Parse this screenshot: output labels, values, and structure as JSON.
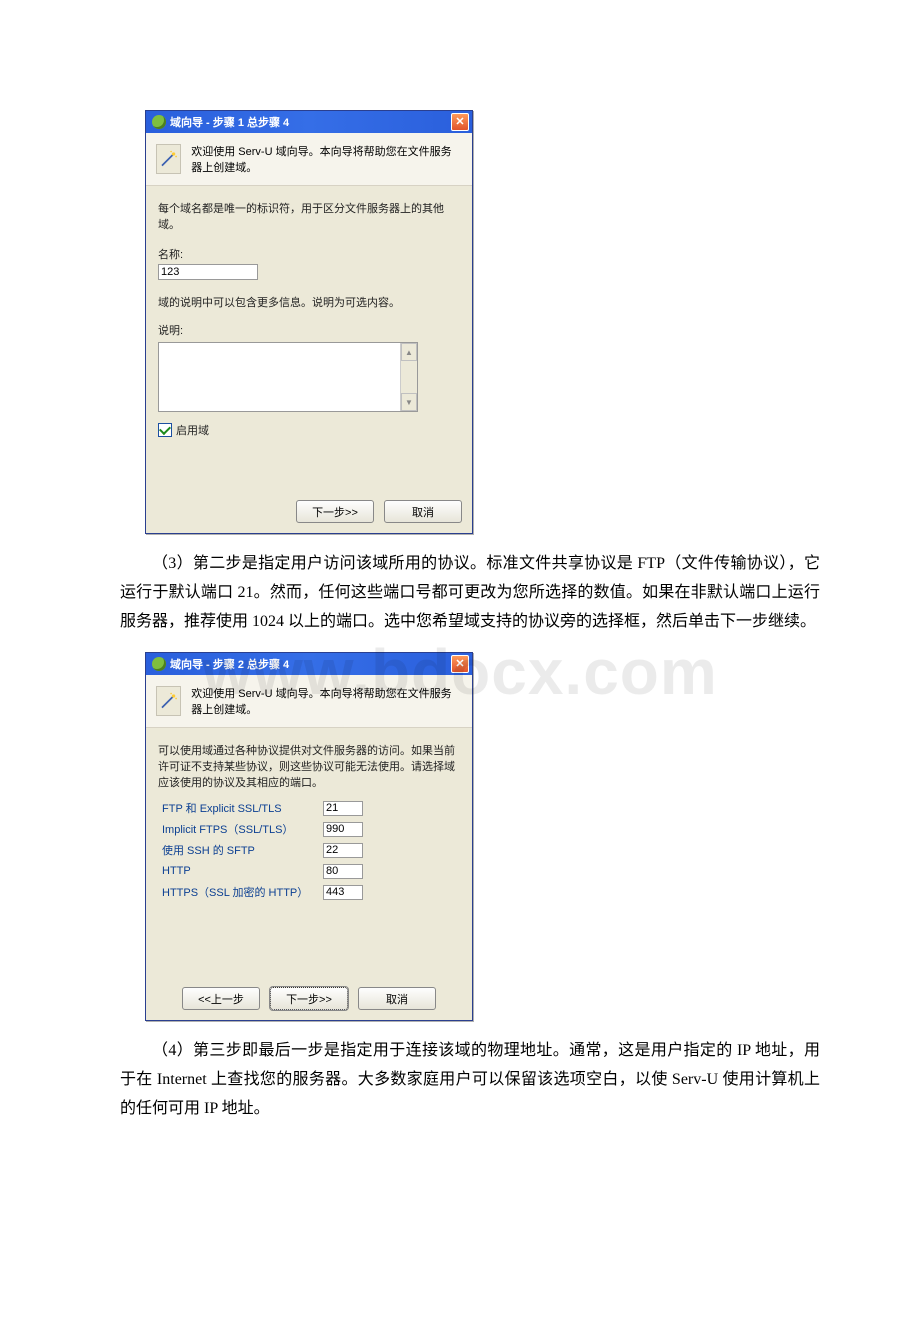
{
  "watermark": "www.bdocx.com",
  "dialog1": {
    "title": "域向导 - 步骤 1 总步骤 4",
    "welcome": "欢迎使用 Serv-U 域向导。本向导将帮助您在文件服务器上创建域。",
    "instruction": "每个域名都是唯一的标识符，用于区分文件服务器上的其他域。",
    "name_label": "名称:",
    "name_value": "123",
    "desc_note": "域的说明中可以包含更多信息。说明为可选内容。",
    "desc_label": "说明:",
    "enable_label": "启用域",
    "next_btn": "下一步>>",
    "cancel_btn": "取消"
  },
  "paragraph1": "（3）第二步是指定用户访问该域所用的协议。标准文件共享协议是 FTP（文件传输协议），它运行于默认端口 21。然而，任何这些端口号都可更改为您所选择的数值。如果在非默认端口上运行服务器，推荐使用 1024 以上的端口。选中您希望域支持的协议旁的选择框，然后单击下一步继续。",
  "dialog2": {
    "title": "域向导 - 步骤 2 总步骤 4",
    "welcome": "欢迎使用 Serv-U 域向导。本向导将帮助您在文件服务器上创建域。",
    "instruction": "可以使用域通过各种协议提供对文件服务器的访问。如果当前许可证不支持某些协议，则这些协议可能无法使用。请选择域应该使用的协议及其相应的端口。",
    "protocols": [
      {
        "label": "FTP 和 Explicit SSL/TLS",
        "port": "21"
      },
      {
        "label": "Implicit FTPS（SSL/TLS）",
        "port": "990"
      },
      {
        "label": "使用 SSH 的 SFTP",
        "port": "22"
      },
      {
        "label": "HTTP",
        "port": "80"
      },
      {
        "label": "HTTPS（SSL 加密的 HTTP）",
        "port": "443"
      }
    ],
    "prev_btn": "<<上一步",
    "next_btn": "下一步>>",
    "cancel_btn": "取消"
  },
  "paragraph2": "（4）第三步即最后一步是指定用于连接该域的物理地址。通常，这是用户指定的 IP 地址，用于在 Internet 上查找您的服务器。大多数家庭用户可以保留该选项空白，以使 Serv-U 使用计算机上的任何可用 IP 地址。"
}
